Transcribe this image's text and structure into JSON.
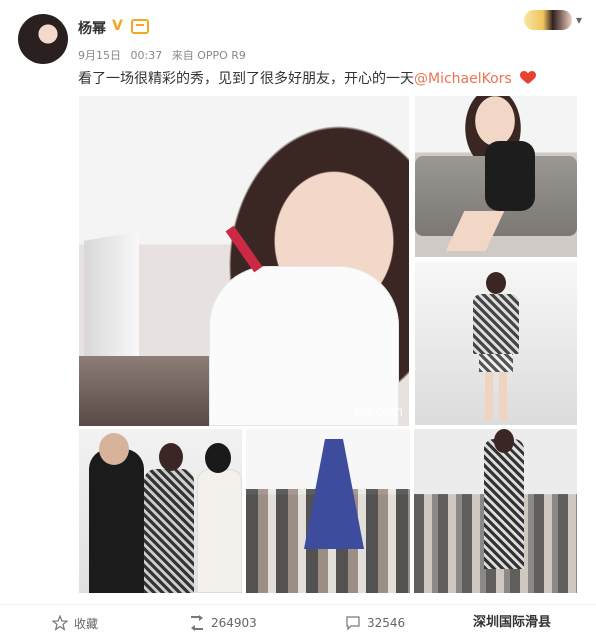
{
  "post": {
    "username": "杨幂",
    "date": "9月15日",
    "time": "00:37",
    "source": "来自 OPPO R9",
    "text_main": "看了一场很精彩的秀，见到了很多好朋友，开心的一天",
    "mention": "@MichaelKors",
    "image_watermark": "bo.com"
  },
  "actions": {
    "favorite_label": "收藏",
    "repost_count": "264903",
    "comment_count": "32546"
  },
  "corner_brand": "深圳国际滑县",
  "colors": {
    "mention": "#eb7350",
    "verified_badge": "#f5a623",
    "heart": "#e8412f"
  },
  "icons": [
    "verified-v-icon",
    "member-badge-icon",
    "heart-emoji-icon",
    "star-icon",
    "repost-icon",
    "comment-icon",
    "chevron-down-icon"
  ]
}
